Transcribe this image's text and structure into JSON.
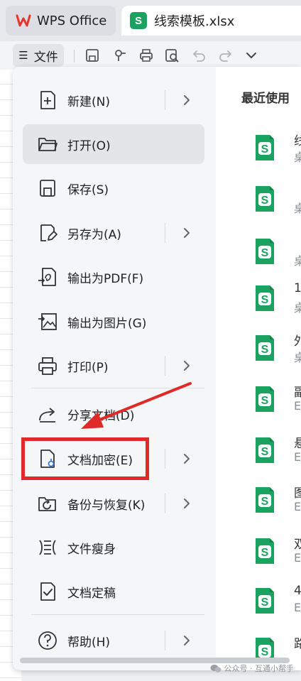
{
  "titlebar": {
    "app_tab_label": "WPS Office",
    "file_tab_label": "线索模板.xlsx",
    "file_badge": "S"
  },
  "toolbar": {
    "file_menu_label": "文件"
  },
  "menu": {
    "items": [
      {
        "label": "新建(N)",
        "icon": "new-document-icon",
        "submenu": true
      },
      {
        "label": "打开(O)",
        "icon": "folder-open-icon",
        "submenu": false
      },
      {
        "label": "保存(S)",
        "icon": "save-icon",
        "submenu": false
      },
      {
        "label": "另存为(A)",
        "icon": "save-as-icon",
        "submenu": true
      },
      {
        "label": "输出为PDF(F)",
        "icon": "export-pdf-icon",
        "submenu": false
      },
      {
        "label": "输出为图片(G)",
        "icon": "export-image-icon",
        "submenu": false
      },
      {
        "label": "打印(P)",
        "icon": "printer-icon",
        "submenu": true
      },
      {
        "label": "分享文档(D)",
        "icon": "share-icon",
        "submenu": false
      },
      {
        "label": "文档加密(E)",
        "icon": "encrypt-document-icon",
        "submenu": true
      },
      {
        "label": "备份与恢复(K)",
        "icon": "backup-restore-icon",
        "submenu": true
      },
      {
        "label": "文件瘦身",
        "icon": "file-slim-icon",
        "submenu": false
      },
      {
        "label": "文档定稿",
        "icon": "finalize-document-icon",
        "submenu": false
      },
      {
        "label": "帮助(H)",
        "icon": "help-icon",
        "submenu": true
      }
    ]
  },
  "recent": {
    "title": "最近使用",
    "items": [
      {
        "name": "线",
        "location": "桌"
      },
      {
        "name": "",
        "location": "桌"
      },
      {
        "name": "",
        "location": "桌"
      },
      {
        "name": "1",
        "location": "桌"
      },
      {
        "name": "外",
        "location": "桌"
      },
      {
        "name": "副",
        "location": "E"
      },
      {
        "name": "悬",
        "location": "E"
      },
      {
        "name": "图",
        "location": "E"
      },
      {
        "name": "双",
        "location": "E"
      },
      {
        "name": "4",
        "location": "E"
      },
      {
        "name": "路",
        "location": ""
      }
    ]
  },
  "watermark": {
    "text": "公众号 · 互通小帮手"
  },
  "colors": {
    "accent_green": "#1aa260",
    "annotation_red": "#e02a2a",
    "wps_red": "#e8332a"
  }
}
